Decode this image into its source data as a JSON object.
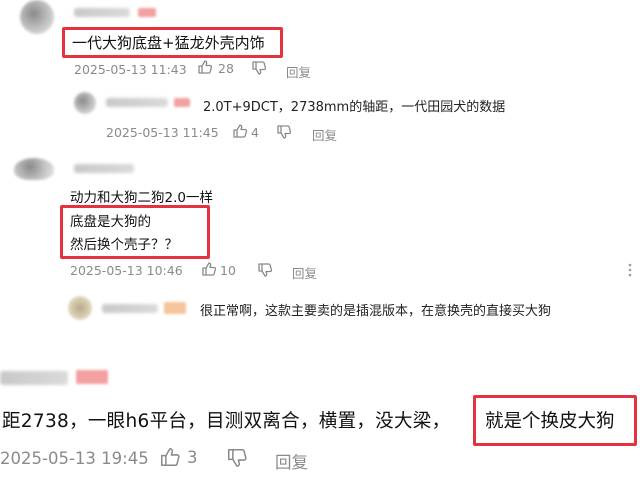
{
  "comments": [
    {
      "text": "一代大狗底盘+猛龙外壳内饰",
      "timestamp": "2025-05-13 11:43",
      "likes": "28",
      "reply_label": "回复"
    },
    {
      "text": "2.0T+9DCT，2738mm的轴距，一代田园犬的数据",
      "timestamp": "2025-05-13 11:45",
      "likes": "4",
      "reply_label": "回复"
    },
    {
      "line1": "动力和大狗二狗2.0一样",
      "line2": "底盘是大狗的",
      "line3": "然后换个壳子？？",
      "timestamp": "2025-05-13 10:46",
      "likes": "10",
      "reply_label": "回复"
    },
    {
      "text": "很正常啊，这款主要卖的是插混版本，在意换壳的直接买大狗"
    },
    {
      "text_main": "距2738，一眼h6平台，目测双离合，横置，没大梁，",
      "text_boxed": "就是个换皮大狗",
      "timestamp": "2025-05-13 19:45",
      "likes": "3",
      "reply_label": "回复"
    }
  ],
  "colors": {
    "highlight_box": "#e5323e",
    "meta_text": "#8a8a8a"
  }
}
